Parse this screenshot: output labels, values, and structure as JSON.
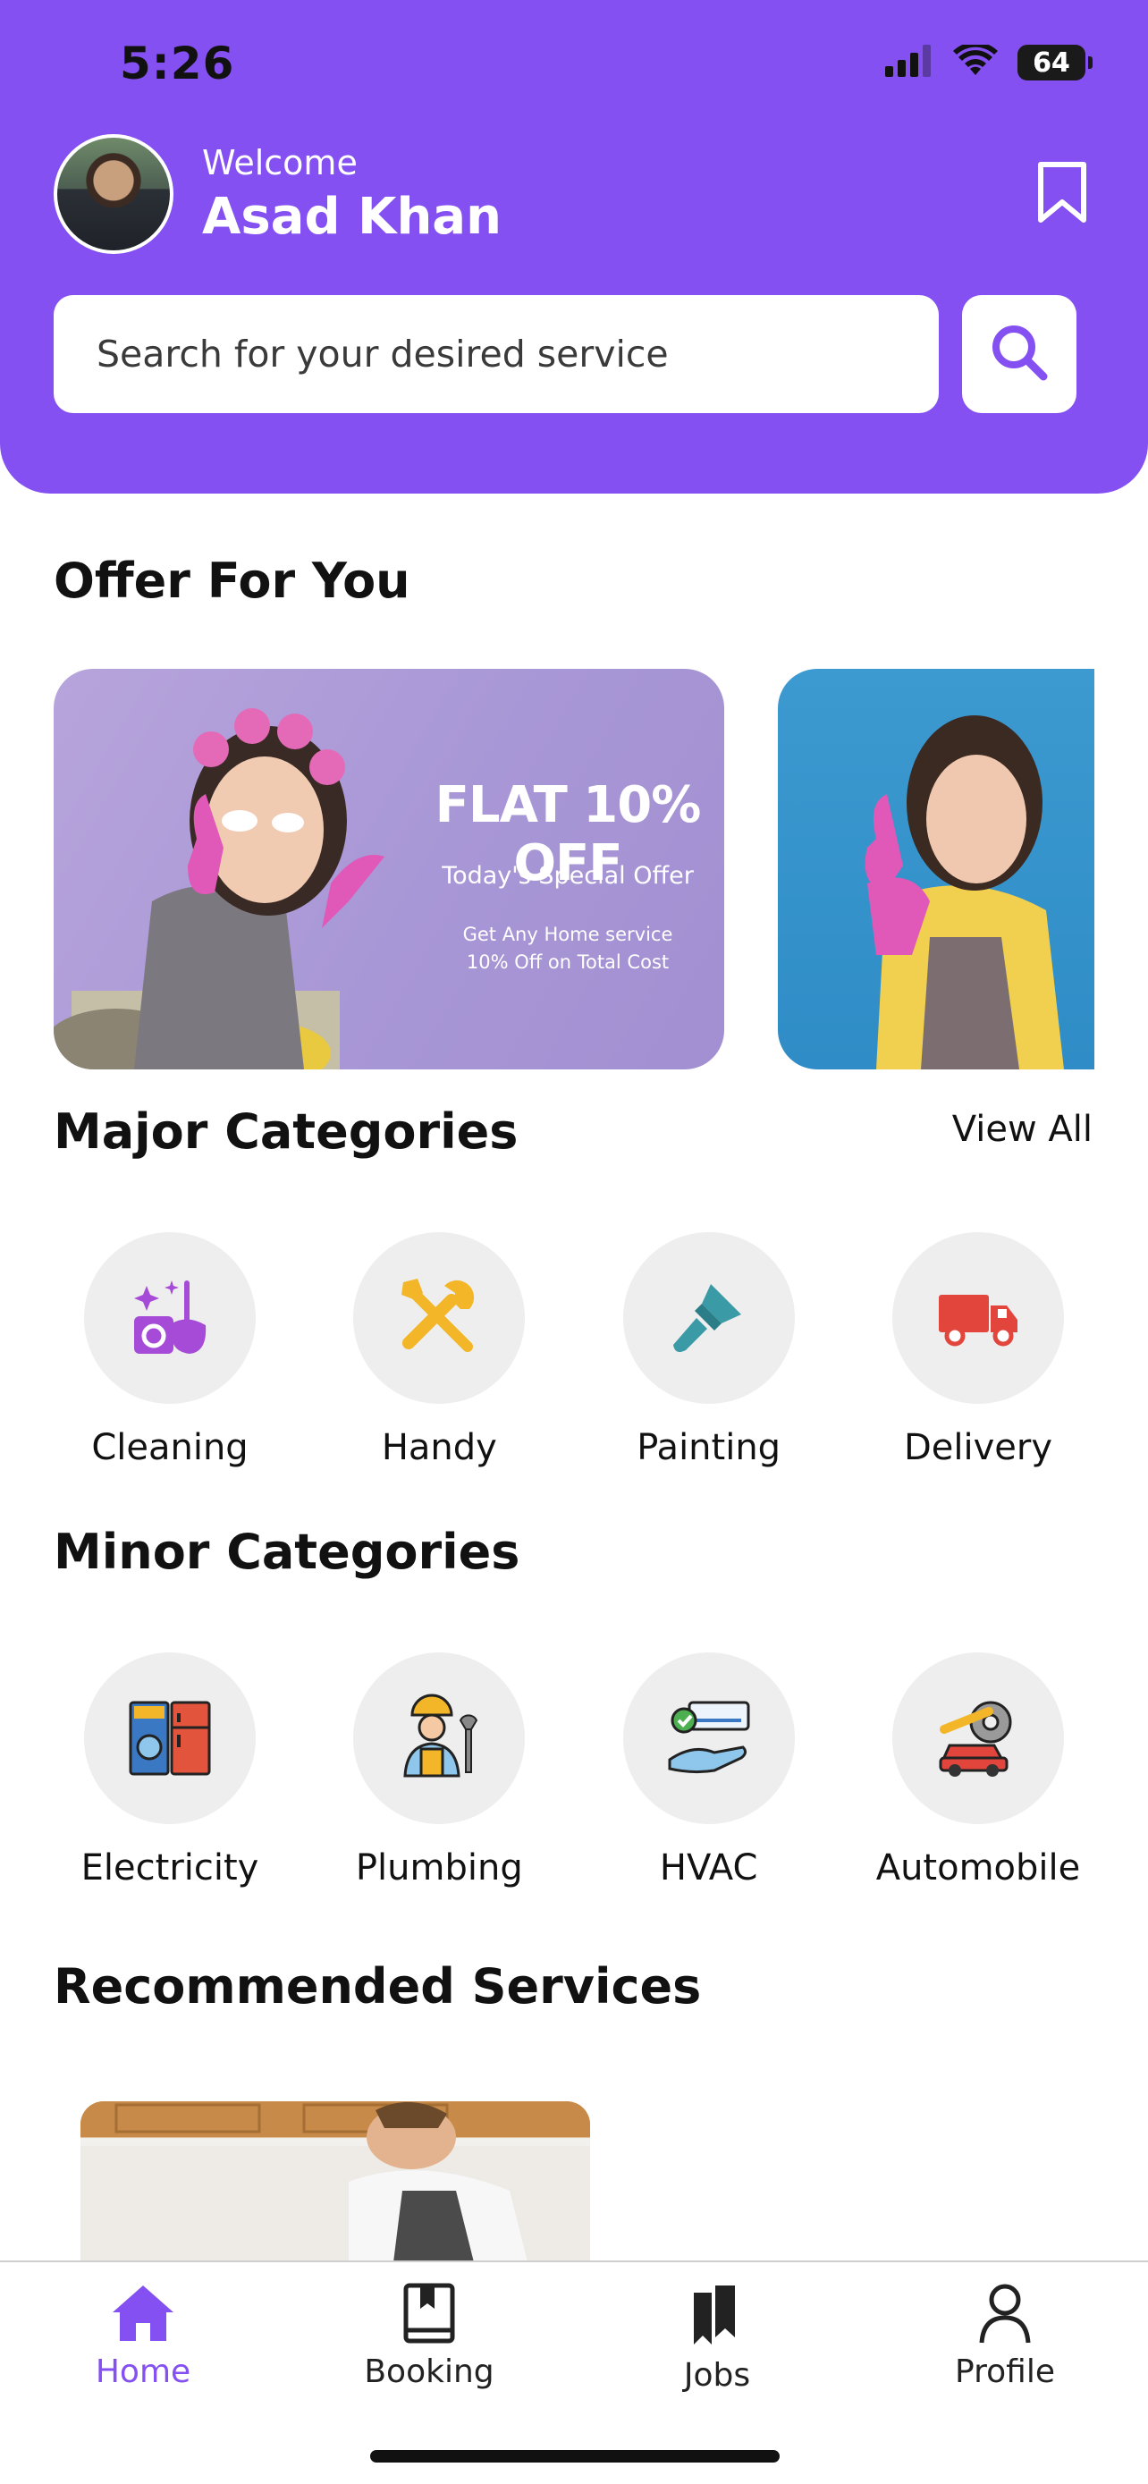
{
  "status_bar": {
    "time": "5:26",
    "battery": "64"
  },
  "header": {
    "welcome": "Welcome",
    "user_name": "Asad Khan",
    "search_placeholder": "Search for your desired service"
  },
  "offers": {
    "title": "Offer For You",
    "cards": [
      {
        "headline": "FLAT 10% OFF",
        "subtitle": "Today's Special Offer",
        "description": "Get Any Home service 10% Off on Total Cost"
      }
    ]
  },
  "major_categories": {
    "title": "Major Categories",
    "view_all": "View All",
    "items": [
      {
        "label": "Cleaning",
        "icon": "cleaning-icon"
      },
      {
        "label": "Handy",
        "icon": "tools-icon"
      },
      {
        "label": "Painting",
        "icon": "paint-brush-icon"
      },
      {
        "label": "Delivery",
        "icon": "truck-icon"
      }
    ]
  },
  "minor_categories": {
    "title": "Minor Categories",
    "items": [
      {
        "label": "Electricity",
        "icon": "appliances-icon"
      },
      {
        "label": "Plumbing",
        "icon": "plumber-icon"
      },
      {
        "label": "HVAC",
        "icon": "air-conditioner-icon"
      },
      {
        "label": "Automobile",
        "icon": "car-repair-icon"
      }
    ]
  },
  "recommended": {
    "title": "Recommended Services"
  },
  "tabbar": {
    "active": "Home",
    "tabs": [
      {
        "label": "Home",
        "icon": "home-icon"
      },
      {
        "label": "Booking",
        "icon": "book-icon"
      },
      {
        "label": "Jobs",
        "icon": "jobs-icon"
      },
      {
        "label": "Profile",
        "icon": "profile-icon"
      }
    ]
  },
  "colors": {
    "brand": "#8550F2",
    "category_bg": "#EEEEEE",
    "paint_teal": "#3A9AA6",
    "truck_red": "#E2453C"
  }
}
